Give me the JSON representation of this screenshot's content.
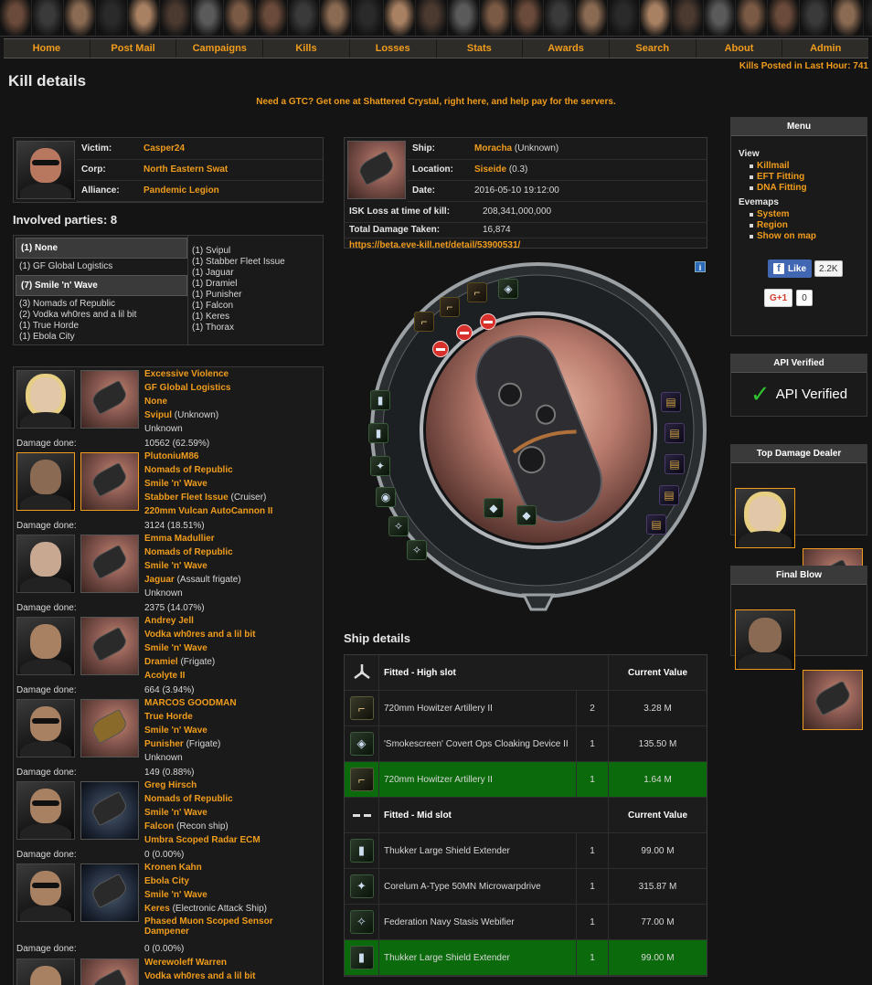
{
  "nav": [
    "Home",
    "Post Mail",
    "Campaigns",
    "Kills",
    "Losses",
    "Stats",
    "Awards",
    "Search",
    "About",
    "Admin"
  ],
  "kills_posted": "Kills Posted in Last Hour: 741",
  "page_title": "Kill details",
  "gtc_text": "Need a GTC? Get one at Shattered Crystal, right here, and help pay for the servers.",
  "victim": {
    "labels": {
      "victim": "Victim:",
      "corp": "Corp:",
      "alliance": "Alliance:"
    },
    "name": "Casper24",
    "corp": "North Eastern Swat",
    "alliance": "Pandemic Legion"
  },
  "ship_info": {
    "labels": {
      "ship": "Ship:",
      "location": "Location:",
      "date": "Date:",
      "isk": "ISK Loss at time of kill:",
      "damage": "Total Damage Taken:"
    },
    "ship": "Moracha",
    "ship_class": "(Unknown)",
    "location": "Siseide",
    "security": "(0.3)",
    "date": "2016-05-10 19:12:00",
    "isk_loss": "208,341,000,000",
    "total_damage": "16,874",
    "link": "https://beta.eve-kill.net/detail/53900531/"
  },
  "involved": {
    "title": "Involved parties: 8",
    "groups": [
      {
        "header": "(1) None",
        "members": [
          "(1) GF Global Logistics"
        ]
      },
      {
        "header": "(7) Smile 'n' Wave",
        "members": [
          "(3) Nomads of Republic",
          "(2) Vodka wh0res and a lil bit",
          "(1) True Horde",
          "(1) Ebola City"
        ]
      }
    ],
    "ships": [
      "(1) Svipul",
      "(1) Stabber Fleet Issue",
      "(1) Jaguar",
      "(1) Dramiel",
      "(1) Punisher",
      "(1) Falcon",
      "(1) Keres",
      "(1) Thorax"
    ]
  },
  "damage_label": "Damage done:",
  "attackers": [
    {
      "name": "Excessive Violence",
      "corp": "GF Global Logistics",
      "alliance": "None",
      "ship": "Svipul",
      "ship_class": "(Unknown)",
      "weapon": "Unknown",
      "weapon_link": false,
      "damage": "10562 (62.59%)"
    },
    {
      "name": "PlutoniuM86",
      "corp": "Nomads of Republic",
      "alliance": "Smile 'n' Wave",
      "ship": "Stabber Fleet Issue",
      "ship_class": "(Cruiser)",
      "weapon": "220mm Vulcan AutoCannon II",
      "weapon_link": true,
      "damage": "3124 (18.51%)"
    },
    {
      "name": "Emma Madullier",
      "corp": "Nomads of Republic",
      "alliance": "Smile 'n' Wave",
      "ship": "Jaguar",
      "ship_class": "(Assault frigate)",
      "weapon": "Unknown",
      "weapon_link": false,
      "damage": "2375 (14.07%)"
    },
    {
      "name": "Andrey Jell",
      "corp": "Vodka wh0res and a lil bit",
      "alliance": "Smile 'n' Wave",
      "ship": "Dramiel",
      "ship_class": "(Frigate)",
      "weapon": "Acolyte II",
      "weapon_link": true,
      "damage": "664 (3.94%)"
    },
    {
      "name": "MARCOS GOODMAN",
      "corp": "True Horde",
      "alliance": "Smile 'n' Wave",
      "ship": "Punisher",
      "ship_class": "(Frigate)",
      "weapon": "Unknown",
      "weapon_link": false,
      "damage": "149 (0.88%)"
    },
    {
      "name": "Greg Hirsch",
      "corp": "Nomads of Republic",
      "alliance": "Smile 'n' Wave",
      "ship": "Falcon",
      "ship_class": "(Recon ship)",
      "weapon": "Umbra Scoped Radar ECM",
      "weapon_link": true,
      "damage": "0 (0.00%)"
    },
    {
      "name": "Kronen Kahn",
      "corp": "Ebola City",
      "alliance": "Smile 'n' Wave",
      "ship": "Keres",
      "ship_class": "(Electronic Attack Ship)",
      "weapon": "Phased Muon Scoped Sensor",
      "weapon2": "Dampener",
      "weapon_link": true,
      "damage": "0 (0.00%)"
    },
    {
      "name": "Werewoleff Warren",
      "corp": "Vodka wh0res and a lil bit",
      "alliance": "",
      "ship": "",
      "ship_class": "",
      "weapon": "",
      "weapon_link": false,
      "damage": ""
    }
  ],
  "sidebar": {
    "menu_title": "Menu",
    "view_label": "View",
    "view_items": [
      "Killmail",
      "EFT Fitting",
      "DNA Fitting"
    ],
    "evemaps_label": "Evemaps",
    "evemaps_items": [
      "System",
      "Region",
      "Show on map"
    ],
    "like_label": "Like",
    "like_count": "2.2K",
    "gplus_label": "G+1",
    "gplus_count": "0",
    "api_title": "API Verified",
    "api_text": "API Verified",
    "top_damage_title": "Top Damage Dealer",
    "final_blow_title": "Final Blow"
  },
  "ship_details": {
    "title": "Ship details",
    "sections": [
      {
        "header": "Fitted - High slot",
        "value_header": "Current Value",
        "rows": [
          {
            "name": "720mm Howitzer Artillery II",
            "qty": "2",
            "value": "3.28 M",
            "fitted": false
          },
          {
            "name": "'Smokescreen' Covert Ops Cloaking Device II",
            "qty": "1",
            "value": "135.50 M",
            "fitted": false
          },
          {
            "name": "720mm Howitzer Artillery II",
            "qty": "1",
            "value": "1.64 M",
            "fitted": true
          }
        ]
      },
      {
        "header": "Fitted - Mid slot",
        "value_header": "Current Value",
        "rows": [
          {
            "name": "Thukker Large Shield Extender",
            "qty": "1",
            "value": "99.00 M",
            "fitted": false
          },
          {
            "name": "Corelum A-Type 50MN Microwarpdrive",
            "qty": "1",
            "value": "315.87 M",
            "fitted": false
          },
          {
            "name": "Federation Navy Stasis Webifier",
            "qty": "1",
            "value": "77.00 M",
            "fitted": false
          },
          {
            "name": "Thukker Large Shield Extender",
            "qty": "1",
            "value": "99.00 M",
            "fitted": true
          }
        ]
      }
    ]
  }
}
